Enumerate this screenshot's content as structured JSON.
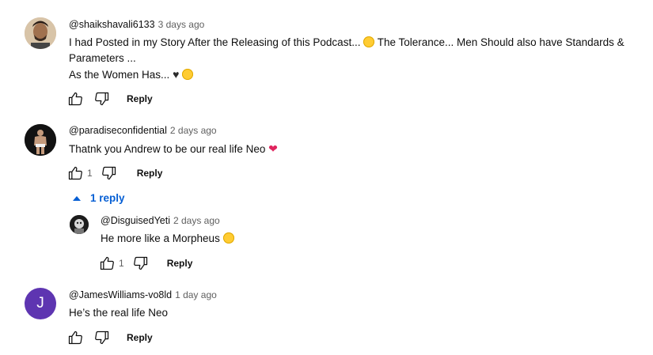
{
  "comments": [
    {
      "author": "@shaikshavali6133",
      "time": "3 days ago",
      "line1": "I had Posted in my Story After the Releasing of this Podcast...",
      "line1b": " The Tolerance... Men Should also have Standards &",
      "line2": "Parameters ...",
      "line3": "As the Women Has...",
      "likes": "",
      "reply_label": "Reply"
    },
    {
      "author": "@paradiseconfidential",
      "time": "2 days ago",
      "line1": "Thatnk you Andrew to be our real life Neo",
      "likes": "1",
      "reply_label": "Reply",
      "replies_toggle": "1 reply"
    },
    {
      "author": "@DisguisedYeti",
      "time": "2 days ago",
      "line1": "He more like a Morpheus",
      "likes": "1",
      "reply_label": "Reply"
    },
    {
      "author": "@JamesWilliams-vo8ld",
      "time": "1 day ago",
      "line1": "He’s the real life Neo",
      "avatar_letter": "J",
      "avatar_color": "#5e35b1",
      "likes": "",
      "reply_label": "Reply"
    }
  ],
  "colors": {
    "link": "#065fd4",
    "muted": "#606060"
  }
}
